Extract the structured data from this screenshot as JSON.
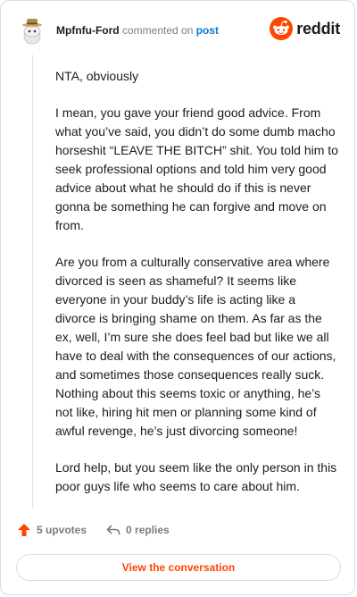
{
  "header": {
    "username": "Mpfnfu-Ford",
    "action_text": "commented on",
    "post_link": "post",
    "brand": "reddit"
  },
  "comment": {
    "paragraphs": [
      "NTA, obviously",
      "I mean, you gave your friend good advice. From what you’ve said, you didn’t do some dumb macho horseshit “LEAVE THE BITCH” shit. You told him to seek professional options and told him very good advice about what he should do if this is never gonna be something he can forgive and move on from.",
      "Are you from a culturally conservative area where divorced is seen as shameful? It seems like everyone in your buddy’s life is acting like a divorce is bringing shame on them. As far as the ex, well, I’m sure she does feel bad but like we all have to deal with the consequences of our actions, and sometimes those consequences really suck. Nothing about this seems toxic or anything, he’s not like, hiring hit men or planning some kind of awful revenge, he’s just divorcing someone!",
      "Lord help, but you seem like the only person in this poor guys life who seems to care about him."
    ]
  },
  "actions": {
    "upvotes": "5 upvotes",
    "replies": "0 replies"
  },
  "cta": {
    "label": "View the conversation"
  },
  "colors": {
    "accent": "#ff4500",
    "link": "#0079d3"
  }
}
